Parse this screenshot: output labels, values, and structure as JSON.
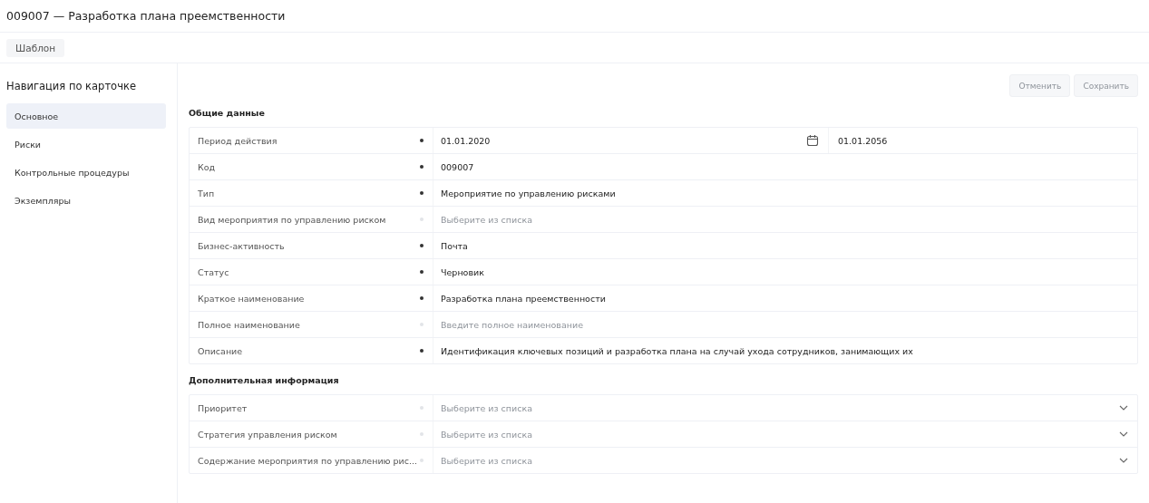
{
  "title": "009007 — Разработка плана преемственности",
  "template_button": "Шаблон",
  "nav": {
    "title": "Навигация по карточке",
    "items": [
      {
        "label": "Основное",
        "selected": true
      },
      {
        "label": "Риски",
        "selected": false
      },
      {
        "label": "Контрольные процедуры",
        "selected": false
      },
      {
        "label": "Экземпляры",
        "selected": false
      }
    ]
  },
  "actions": [
    {
      "label": "Отменить",
      "disabled": true
    },
    {
      "label": "Сохранить",
      "disabled": true
    }
  ],
  "sections": [
    {
      "title": "Общие данные",
      "fields": [
        {
          "kind": "date_range",
          "label": "Период действия",
          "value": "01.01.2020",
          "end_value": "01.01.2056"
        },
        {
          "kind": "text",
          "label": "Код",
          "value": "009007"
        },
        {
          "kind": "text",
          "label": "Тип",
          "value": "Мероприятие по управлению рисками"
        },
        {
          "kind": "text",
          "label": "Вид мероприятия по управлению риском",
          "placeholder": "Выберите из списка"
        },
        {
          "kind": "text",
          "label": "Бизнес-активность",
          "value": "Почта"
        },
        {
          "kind": "text",
          "label": "Статус",
          "value": "Черновик"
        },
        {
          "kind": "text",
          "label": "Краткое наименование",
          "value": "Разработка плана преемственности"
        },
        {
          "kind": "text",
          "label": "Полное наименование",
          "placeholder": "Введите полное наименование"
        },
        {
          "kind": "text",
          "label": "Описание",
          "value": "Идентификация ключевых позиций и разработка плана на случай ухода сотрудников, занимающих их"
        }
      ]
    },
    {
      "title": "Дополнительная информация",
      "fields": [
        {
          "kind": "select",
          "label": "Приоритет",
          "placeholder": "Выберите из списка"
        },
        {
          "kind": "select",
          "label": "Стратегия управления риском",
          "placeholder": "Выберите из списка"
        },
        {
          "kind": "select",
          "label": "Содержание мероприятия по управлению рис...",
          "placeholder": "Выберите из списка"
        }
      ]
    }
  ]
}
